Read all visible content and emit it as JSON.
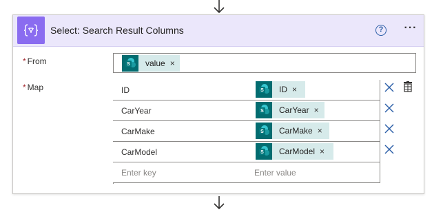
{
  "action": {
    "title": "Select: Search Result Columns",
    "icon": "variable-braces-icon",
    "help_label": "?",
    "more_label": "···",
    "accent_color": "#8a6cf0",
    "header_bg": "#ebe7fb"
  },
  "from": {
    "label": "From",
    "required_mark": "*",
    "token": {
      "label": "value",
      "icon": "sharepoint-icon",
      "remove": "×"
    }
  },
  "map": {
    "label": "Map",
    "required_mark": "*",
    "rows": [
      {
        "key": "ID",
        "value_token": "ID",
        "remove": "×"
      },
      {
        "key": "CarYear",
        "value_token": "CarYear",
        "remove": "×"
      },
      {
        "key": "CarMake",
        "value_token": "CarMake",
        "remove": "×"
      },
      {
        "key": "CarModel",
        "value_token": "CarModel",
        "remove": "×"
      }
    ],
    "key_placeholder": "Enter key",
    "value_placeholder": "Enter value"
  },
  "colors": {
    "token_bg": "#d6eaea",
    "sharepoint_teal": "#036c70",
    "link_blue": "#2b5ea7",
    "required_red": "#a4262c"
  }
}
